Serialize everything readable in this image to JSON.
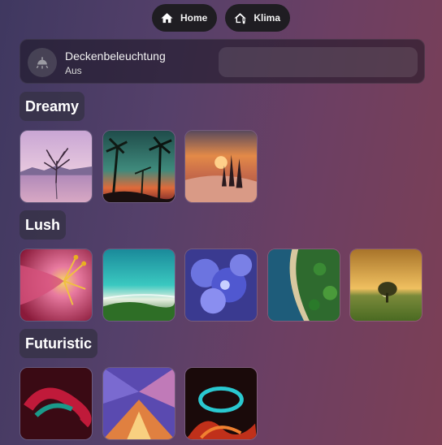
{
  "nav": {
    "home_label": "Home",
    "home_icon": "home-icon",
    "climate_label": "Klima",
    "climate_icon": "home-thermometer-icon"
  },
  "light": {
    "name": "Deckenbeleuchtung",
    "state": "Aus",
    "icon": "ceiling-light-icon"
  },
  "sections": [
    {
      "label": "Dreamy",
      "tiles": [
        {
          "name": "lone-tree-lake-tile"
        },
        {
          "name": "palm-trees-sunset-tile"
        },
        {
          "name": "snowy-trees-sunset-tile"
        }
      ]
    },
    {
      "label": "Lush",
      "tiles": [
        {
          "name": "pink-lily-flower-tile"
        },
        {
          "name": "turquoise-coast-tile"
        },
        {
          "name": "blue-hydrangea-tile"
        },
        {
          "name": "aerial-forest-coast-tile"
        },
        {
          "name": "meadow-tree-sunset-tile"
        }
      ]
    },
    {
      "label": "Futuristic",
      "tiles": [
        {
          "name": "red-teal-swirl-tile"
        },
        {
          "name": "polygon-crystal-tile"
        },
        {
          "name": "cosmic-fire-swirl-tile"
        }
      ]
    }
  ]
}
